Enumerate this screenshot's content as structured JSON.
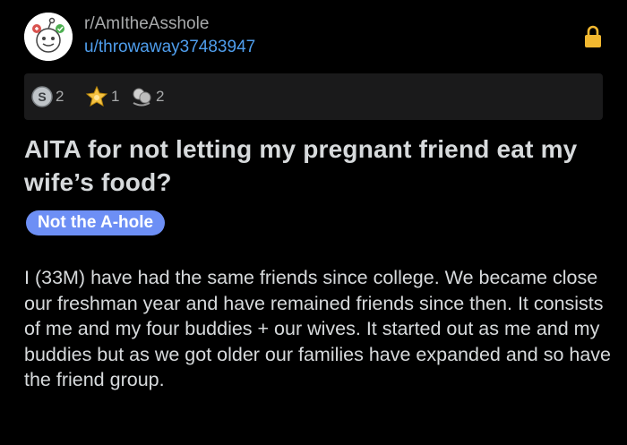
{
  "header": {
    "subreddit": "r/AmItheAsshole",
    "username": "u/throwaway37483947",
    "lock_icon": "lock-icon"
  },
  "awards": [
    {
      "icon": "silver-award-icon",
      "count": "2"
    },
    {
      "icon": "gold-star-award-icon",
      "count": "1"
    },
    {
      "icon": "wholesome-hug-award-icon",
      "count": "2"
    }
  ],
  "post": {
    "title": "AITA for not letting my pregnant friend eat my wife’s food?",
    "flair": "Not the A-hole",
    "body": "I (33M) have had the same friends since college. We became close our freshman year and have remained friends since then. It consists of me and my four buddies + our wives. It started out as me and my buddies but as we got older our families have expanded and so have the friend group."
  },
  "colors": {
    "background": "#000000",
    "award_bar": "#1a1a1b",
    "username": "#4f9eed",
    "flair_bg": "#6d8ff5",
    "lock": "#f2b830"
  }
}
